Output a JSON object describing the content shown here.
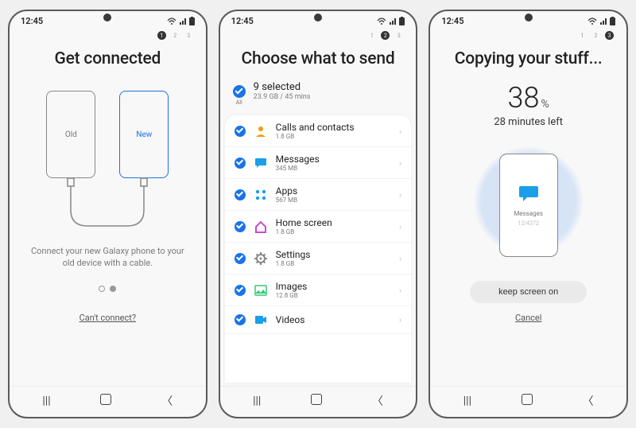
{
  "status": {
    "time": "12:45"
  },
  "screen1": {
    "step_active": 1,
    "title": "Get connected",
    "old_label": "Old",
    "new_label": "New",
    "description": "Connect your new Galaxy phone to your old device with a cable.",
    "cant_connect": "Can't connect?"
  },
  "screen2": {
    "step_active": 2,
    "title": "Choose what to send",
    "all_label": "All",
    "selected_count": "9 selected",
    "selected_detail": "23.9 GB / 45 mins",
    "items": [
      {
        "label": "Calls and contacts",
        "detail": "1.8 GB",
        "icon": "contacts",
        "color": "#f39c12"
      },
      {
        "label": "Messages",
        "detail": "345 MB",
        "icon": "messages",
        "color": "#1a9fe8"
      },
      {
        "label": "Apps",
        "detail": "567 MB",
        "icon": "apps",
        "color": "#1a9fe8"
      },
      {
        "label": "Home screen",
        "detail": "1.8 GB",
        "icon": "home",
        "color": "#c94cc9"
      },
      {
        "label": "Settings",
        "detail": "1.8 GB",
        "icon": "settings",
        "color": "#888888"
      },
      {
        "label": "Images",
        "detail": "12.8 GB",
        "icon": "images",
        "color": "#2ecc71"
      },
      {
        "label": "Videos",
        "detail": "",
        "icon": "videos",
        "color": "#1a9fe8"
      }
    ]
  },
  "screen3": {
    "step_active": 3,
    "title": "Copying your stuff...",
    "percent": "38",
    "percent_sym": "%",
    "eta": "28 minutes left",
    "current_item": "Messages",
    "current_count": "12/4372",
    "keep_screen_on": "keep screen on",
    "cancel": "Cancel"
  },
  "steps": [
    "1",
    "2",
    "3"
  ]
}
